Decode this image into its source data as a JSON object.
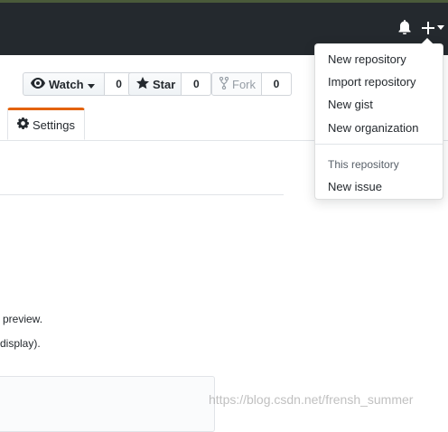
{
  "header": {
    "icons": [
      "bell-icon",
      "plus-icon",
      "caret-down-icon"
    ]
  },
  "repo_actions": {
    "watch": {
      "label": "Watch",
      "count": "0"
    },
    "star": {
      "label": "Star",
      "count": "0"
    },
    "fork": {
      "label": "Fork",
      "count": "0"
    }
  },
  "tabs": {
    "settings": "Settings"
  },
  "content": {
    "line1": "preview.",
    "line2": "display)."
  },
  "dropdown": {
    "items": [
      "New repository",
      "Import repository",
      "New gist",
      "New organization"
    ],
    "section_header": "This repository",
    "section_items": [
      "New issue"
    ]
  },
  "watermark": "https://blog.csdn.net/frensh_summer",
  "colors": {
    "topbar": "#24292e",
    "tab_accent": "#e36209",
    "border": "#e1e4e8"
  }
}
